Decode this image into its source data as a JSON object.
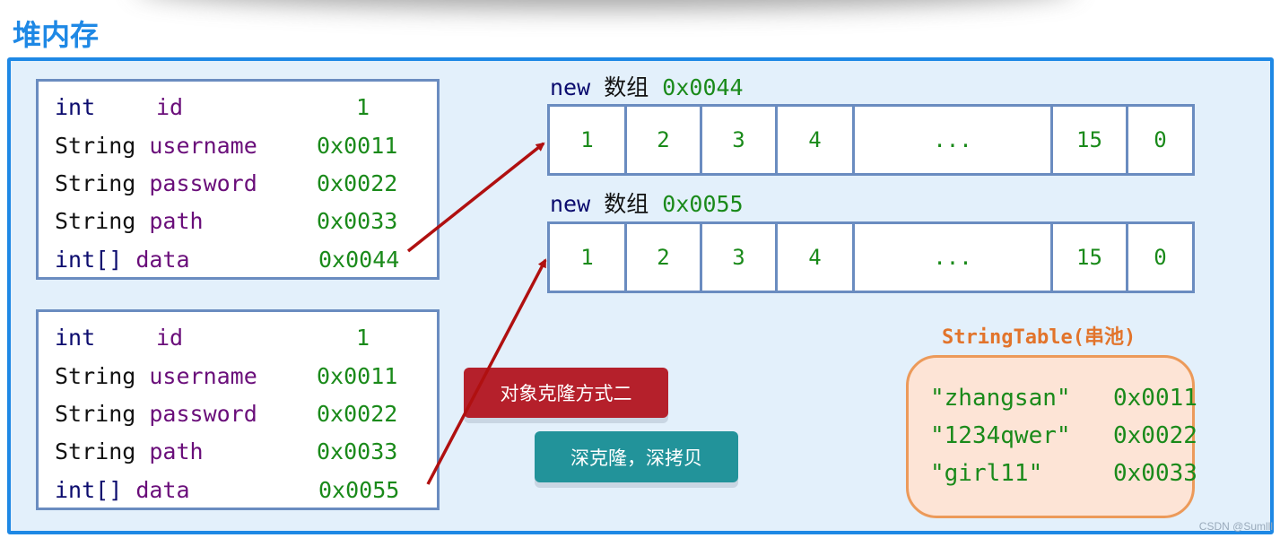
{
  "title": "堆内存",
  "objects": [
    {
      "fields": [
        {
          "type": "int",
          "name": "id",
          "value": "1"
        },
        {
          "type": "String",
          "name": "username",
          "value": "0x0011"
        },
        {
          "type": "String",
          "name": "password",
          "value": "0x0022"
        },
        {
          "type": "String",
          "name": "path",
          "value": "0x0033"
        },
        {
          "type": "int[]",
          "name": "data",
          "value": "0x0044"
        }
      ]
    },
    {
      "fields": [
        {
          "type": "int",
          "name": "id",
          "value": "1"
        },
        {
          "type": "String",
          "name": "username",
          "value": "0x0011"
        },
        {
          "type": "String",
          "name": "password",
          "value": "0x0022"
        },
        {
          "type": "String",
          "name": "path",
          "value": "0x0033"
        },
        {
          "type": "int[]",
          "name": "data",
          "value": "0x0055"
        }
      ]
    }
  ],
  "arrays": [
    {
      "keyword": "new",
      "label": "数组",
      "address": "0x0044",
      "cells": [
        "1",
        "2",
        "3",
        "4",
        "...",
        "15",
        "0"
      ]
    },
    {
      "keyword": "new",
      "label": "数组",
      "address": "0x0055",
      "cells": [
        "1",
        "2",
        "3",
        "4",
        "...",
        "15",
        "0"
      ]
    }
  ],
  "badges": {
    "method": "对象克隆方式二",
    "deep": "深克隆，深拷贝"
  },
  "string_table": {
    "title": "StringTable(串池)",
    "entries": [
      {
        "value": "\"zhangsan\"",
        "address": "0x0011"
      },
      {
        "value": "\"1234qwer\"",
        "address": "0x0022"
      },
      {
        "value": "\"girl11\"",
        "address": "0x0033"
      }
    ]
  },
  "colors": {
    "title": "#1e88e5",
    "arrow": "#b01010",
    "method_badge": "#b5202b",
    "deep_badge": "#22939a"
  },
  "watermark": "CSDN @Sumlll"
}
